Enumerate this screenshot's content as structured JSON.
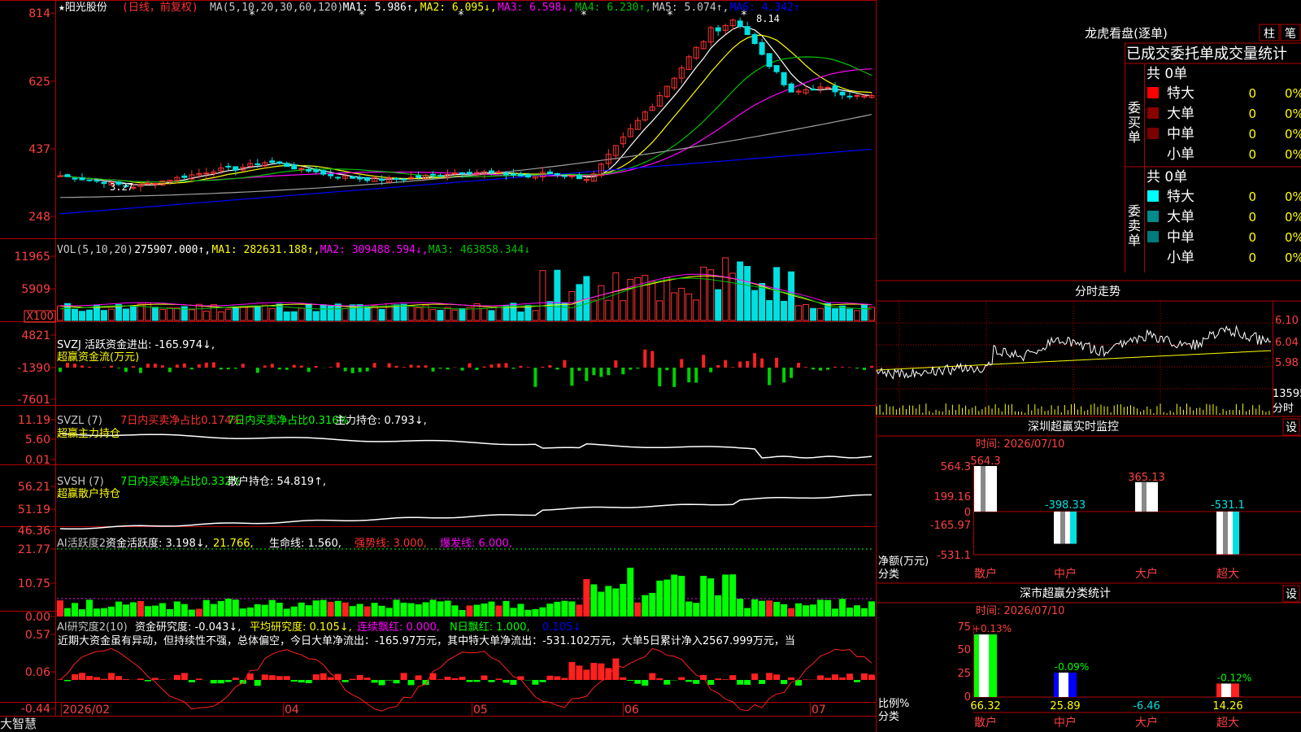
{
  "stock": {
    "name": "★阳光股份",
    "period": "(日线，前复权)"
  },
  "colors": {
    "grid": "#b00000",
    "up": "#ff3232",
    "down": "#00e0e0",
    "ma1": "#ffffff",
    "ma2": "#ffff00",
    "ma3": "#ff00ff",
    "ma4": "#00c000",
    "ma5": "#a0a0a0",
    "ma6": "#0000ff",
    "axis": "#ff4040"
  },
  "main_panel": {
    "ma_legend": [
      {
        "text": "MA(5,10,20,30,60,120)",
        "color": "#c8c8c8"
      },
      {
        "text": "MA1: 5.986↑,",
        "color": "#ffffff"
      },
      {
        "text": "MA2: 6.095↓,",
        "color": "#ffff00"
      },
      {
        "text": "MA3: 6.598↓,",
        "color": "#ff00ff"
      },
      {
        "text": "MA4: 6.230↑,",
        "color": "#00c000"
      },
      {
        "text": "MA5: 5.074↑,",
        "color": "#c8c8c8"
      },
      {
        "text": "MA6: 4.342↑",
        "color": "#0000ff"
      }
    ],
    "y_ticks": [
      "814",
      "625",
      "437",
      "248"
    ],
    "high_label": "8.14",
    "low_label": "3.27"
  },
  "vol_panel": {
    "legend": [
      {
        "text": "VOL(5,10,20)",
        "color": "#c8c8c8"
      },
      {
        "text": "275907.000↑,",
        "color": "#ffffff"
      },
      {
        "text": "MA1: 282631.188↑,",
        "color": "#ffff00"
      },
      {
        "text": "MA2: 309488.594↓,",
        "color": "#ff00ff"
      },
      {
        "text": "MA3: 463858.344↓",
        "color": "#00c000"
      }
    ],
    "y_ticks": [
      "11965",
      "5909",
      "X100"
    ]
  },
  "svzj_panel": {
    "legend1": "SVZJ  活跃资金进出: -165.974↓,",
    "legend2": "超赢资金流(万元)",
    "y_ticks": [
      "4821",
      "-1390",
      "-7601"
    ]
  },
  "svzl_panel": {
    "legend": [
      {
        "text": "SVZL (7)",
        "color": "#c8c8c8"
      },
      {
        "text": "7日内买卖净占比0.174%",
        "color": "#ff3232"
      },
      {
        "text": "7日内买卖净占比0.316%",
        "color": "#00ff00"
      },
      {
        "text": "主力持仓: 0.793↓,",
        "color": "#ffffff"
      }
    ],
    "legend2": "超赢主力持仓",
    "y_ticks": [
      "11.19",
      "5.60",
      "0.01"
    ]
  },
  "svsh_panel": {
    "legend": [
      {
        "text": "SVSH (7)",
        "color": "#c8c8c8"
      },
      {
        "text": "7日内买卖净占比0.332%",
        "color": "#00ff00"
      },
      {
        "text": "散户持仓: 54.819↑,",
        "color": "#ffffff"
      }
    ],
    "legend2": "超赢散户持仓",
    "y_ticks": [
      "56.21",
      "51.19",
      "46.36"
    ]
  },
  "ai1_panel": {
    "legend": [
      {
        "text": "AI活跃度2",
        "color": "#c8c8c8"
      },
      {
        "text": "资金活跃度: 3.198↓,",
        "color": "#ffffff"
      },
      {
        "text": "21.766,",
        "color": "#ffff00"
      },
      {
        "text": "生命线: 1.560,",
        "color": "#ffffff"
      },
      {
        "text": "强势线: 3.000,",
        "color": "#ff3232"
      },
      {
        "text": "爆发线: 6.000,",
        "color": "#ff00ff"
      }
    ],
    "y_ticks": [
      "21.77",
      "10.75",
      "0.00"
    ]
  },
  "ai2_panel": {
    "legend": [
      {
        "text": "AI研究度2(10)",
        "color": "#c8c8c8"
      },
      {
        "text": "资金研究度: -0.043↓,",
        "color": "#ffffff"
      },
      {
        "text": "平均研究度: 0.105↓,",
        "color": "#ffff00"
      },
      {
        "text": "连续飘红: 0.000,",
        "color": "#ff00ff"
      },
      {
        "text": "N日飘红: 1.000,",
        "color": "#00ff00"
      },
      {
        "text": "0.105↓",
        "color": "#0000ff"
      }
    ],
    "comment": "近期大资金虽有异动，但持续性不强，总体偏空，今日大单净流出：-165.97万元，其中特大单净流出：-531.102万元，大单5日累计净入2567.999万元，当",
    "y_ticks": [
      "0.57",
      "0.06",
      "-0.44"
    ]
  },
  "x_axis": {
    "labels": [
      "2026/02",
      "04",
      "05",
      "06",
      "07"
    ]
  },
  "footer": {
    "brand": "大智慧"
  },
  "lhb": {
    "title": "龙虎看盘(逐单)",
    "btn_bar": "柱",
    "btn_pen": "笔",
    "header": "已成交委托单成交量统计",
    "buy": {
      "side": "委买单",
      "total": "共 0单",
      "rows": [
        {
          "label": "特大",
          "count": "0",
          "pct": "0%",
          "color": "#ff0000"
        },
        {
          "label": "大单",
          "count": "0",
          "pct": "0%",
          "color": "#8b0000"
        },
        {
          "label": "中单",
          "count": "0",
          "pct": "0%",
          "color": "#7a0000"
        },
        {
          "label": "小单",
          "count": "0",
          "pct": "0%",
          "color": ""
        }
      ]
    },
    "sell": {
      "side": "委卖单",
      "total": "共 0单",
      "rows": [
        {
          "label": "特大",
          "count": "0",
          "pct": "0%",
          "color": "#00ffff"
        },
        {
          "label": "大单",
          "count": "0",
          "pct": "0%",
          "color": "#008b8b"
        },
        {
          "label": "中单",
          "count": "0",
          "pct": "0%",
          "color": "#007a7a"
        },
        {
          "label": "小单",
          "count": "0",
          "pct": "0%",
          "color": ""
        }
      ]
    }
  },
  "intraday": {
    "title": "分时走势",
    "price_labels": [
      "6.10",
      "6.04",
      "5.98"
    ],
    "vol_label": "13595",
    "unit": "分时"
  },
  "monitor": {
    "title": "深圳超赢实时监控",
    "set_label": "设",
    "time": "时间: 2026/07/10",
    "y_ticks": [
      "564.3",
      "199.16",
      "0",
      "-165.97",
      "-531.1"
    ],
    "unit1": "净额(万元)",
    "unit2": "分类",
    "categories": [
      "散户",
      "中户",
      "大户",
      "超大"
    ],
    "values_text": [
      "564.3",
      "-398.33",
      "365.13",
      "-531.1"
    ]
  },
  "classify": {
    "title": "深市超赢分类统计",
    "set_label": "设",
    "time": "时间: 2026/07/10",
    "y_ticks": [
      "75",
      "50",
      "25",
      "0"
    ],
    "unit1": "比例%",
    "unit2": "分类",
    "categories": [
      "散户",
      "中户",
      "大户",
      "超大"
    ],
    "pct_labels": [
      "+0.13%",
      "-0.09%",
      "",
      "-0.12%"
    ],
    "values_text": [
      "66.32",
      "25.89",
      "-6.46",
      "14.26"
    ]
  },
  "chart_data": [
    {
      "type": "candlestick",
      "title": "阳光股份(日线，前复权)",
      "x_labels": [
        "2026/02",
        "04",
        "05",
        "06",
        "07"
      ],
      "ylim": [
        2.48,
        8.14
      ],
      "y_ticks": [
        8.14,
        6.25,
        4.37,
        2.48
      ],
      "high": 8.14,
      "low": 3.27,
      "series": [
        {
          "name": "MA1",
          "last": 5.986
        },
        {
          "name": "MA2",
          "last": 6.095
        },
        {
          "name": "MA3",
          "last": 6.598
        },
        {
          "name": "MA4",
          "last": 6.23
        },
        {
          "name": "MA5",
          "last": 5.074
        },
        {
          "name": "MA6",
          "last": 4.342
        }
      ]
    },
    {
      "type": "bar",
      "title": "VOL(5,10,20)",
      "y_ticks": [
        11965,
        5909
      ],
      "series": [
        {
          "name": "VOL",
          "last": 275907.0
        },
        {
          "name": "MA1",
          "last": 282631.188
        },
        {
          "name": "MA2",
          "last": 309488.594
        },
        {
          "name": "MA3",
          "last": 463858.344
        }
      ]
    },
    {
      "type": "bar",
      "title": "深圳超赢实时监控",
      "categories": [
        "散户",
        "中户",
        "大户",
        "超大"
      ],
      "values": [
        564.3,
        -398.33,
        365.13,
        -531.1
      ],
      "ylabel": "净额(万元)",
      "ylim": [
        -531.1,
        564.3
      ]
    },
    {
      "type": "bar",
      "title": "深市超赢分类统计",
      "categories": [
        "散户",
        "中户",
        "大户",
        "超大"
      ],
      "values": [
        66.32,
        25.89,
        -6.46,
        14.26
      ],
      "ylabel": "比例%",
      "ylim": [
        0,
        75
      ]
    }
  ]
}
